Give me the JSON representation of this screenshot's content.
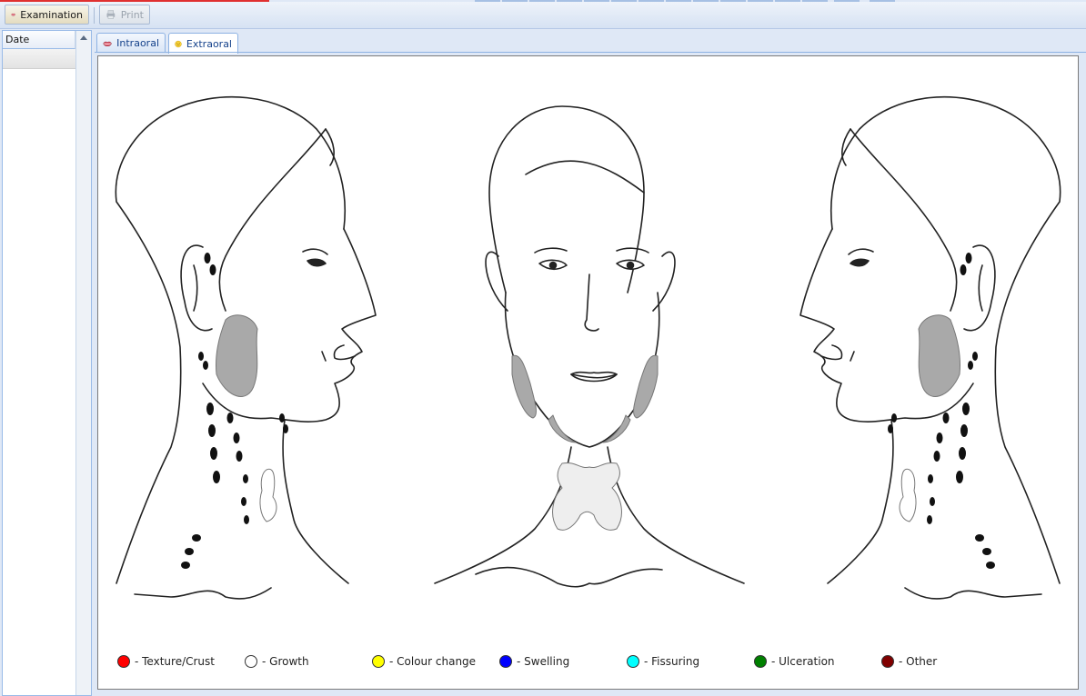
{
  "toolbar": {
    "examination_label": "Examination",
    "print_label": "Print",
    "examination_icon": "lips-icon",
    "print_icon": "printer-icon"
  },
  "left_pane": {
    "header": "Date",
    "rows": [
      ""
    ]
  },
  "tabs": [
    {
      "label": "Intraoral",
      "icon": "lips-icon",
      "active": false
    },
    {
      "label": "Extraoral",
      "icon": "smiley-icon",
      "active": true
    }
  ],
  "legend": [
    {
      "label": "- Texture/Crust",
      "color": "#ff0000"
    },
    {
      "label": "- Growth",
      "color": "#ffffff"
    },
    {
      "label": "- Colour change",
      "color": "#ffff00"
    },
    {
      "label": "- Swelling",
      "color": "#0000ff"
    },
    {
      "label": "- Fissuring",
      "color": "#00ffff"
    },
    {
      "label": "- Ulceration",
      "color": "#008000"
    },
    {
      "label": "- Other",
      "color": "#800000"
    }
  ]
}
